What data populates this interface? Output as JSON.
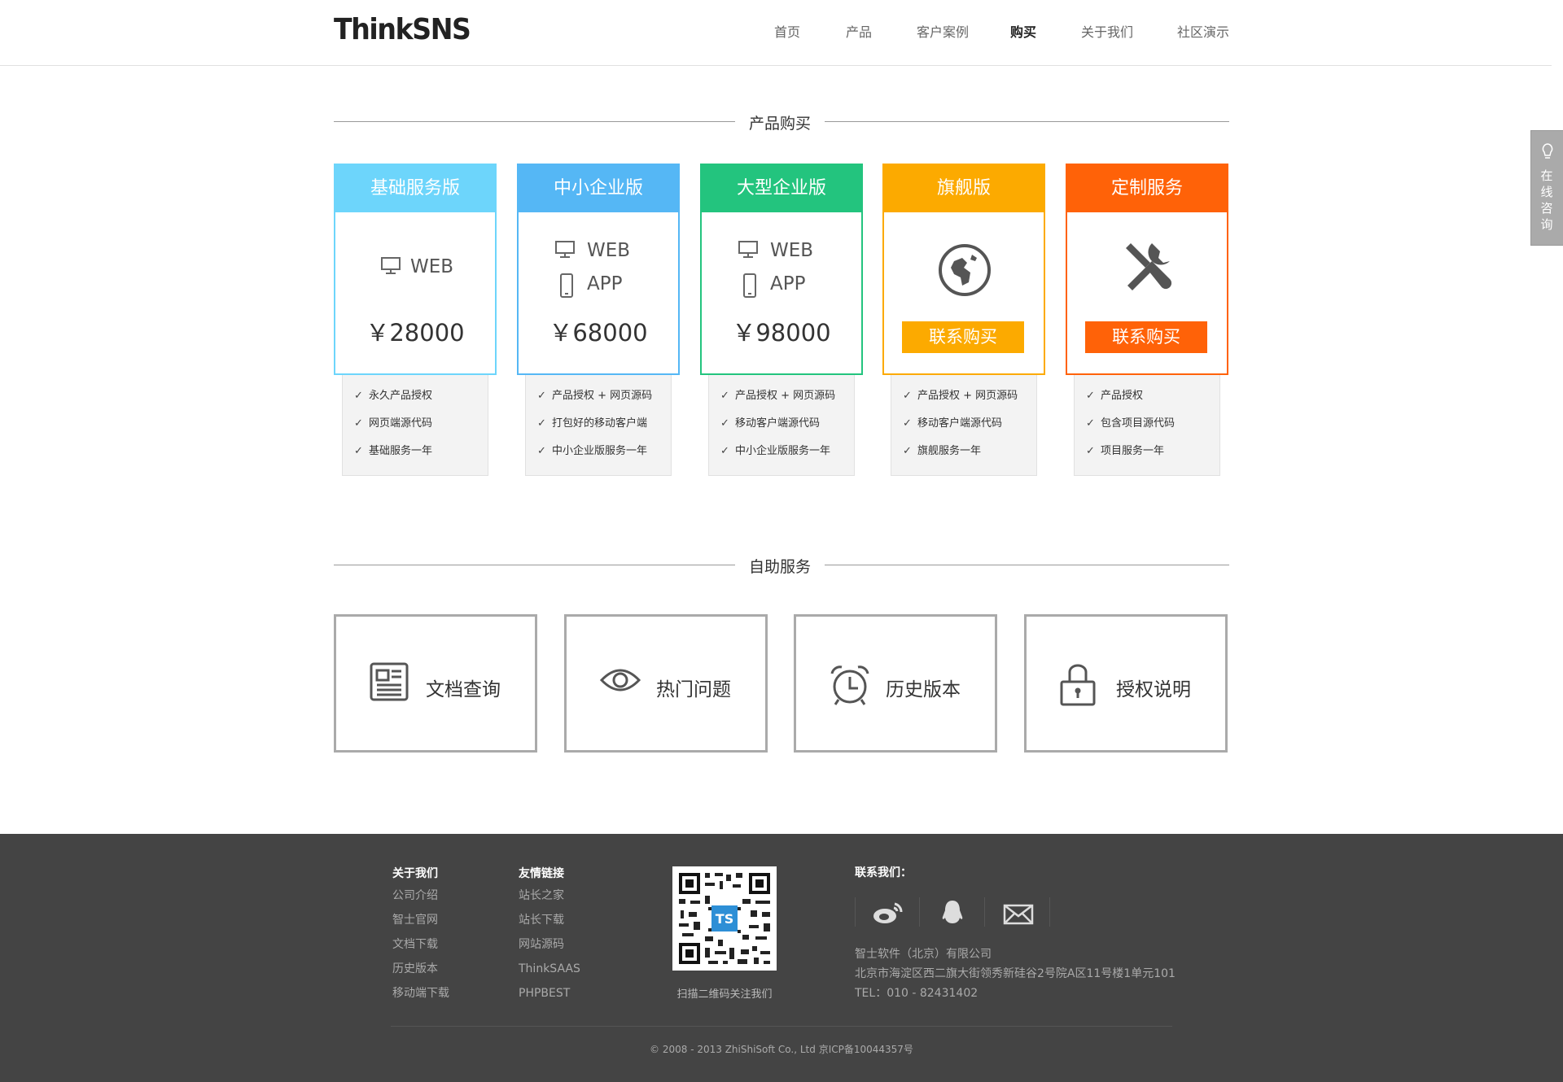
{
  "logo": "ThinkSNS",
  "nav": [
    "首页",
    "产品",
    "客户案例",
    "购买",
    "关于我们",
    "社区演示"
  ],
  "nav_active": "购买",
  "sections": {
    "purchase": "产品购买",
    "self_service": "自助服务"
  },
  "plans": [
    {
      "name": "基础服务版",
      "color": "#6dd5fb",
      "platforms": [
        "WEB"
      ],
      "price": "￥28000",
      "features": [
        "永久产品授权",
        "网页端源代码",
        "基础服务一年"
      ]
    },
    {
      "name": "中小企业版",
      "color": "#55b7f5",
      "platforms": [
        "WEB",
        "APP"
      ],
      "price": "￥68000",
      "features": [
        "产品授权 + 网页源码",
        "打包好的移动客户端",
        "中小企业版服务一年"
      ]
    },
    {
      "name": "大型企业版",
      "color": "#23c47e",
      "platforms": [
        "WEB",
        "APP"
      ],
      "price": "￥98000",
      "features": [
        "产品授权 + 网页源码",
        "移动客户端源代码",
        "中小企业版服务一年"
      ]
    },
    {
      "name": "旗舰版",
      "color": "#fcaa00",
      "icon": "globe-icon",
      "button": "联系购买",
      "features": [
        "产品授权 + 网页源码",
        "移动客户端源代码",
        "旗舰服务一年"
      ]
    },
    {
      "name": "定制服务",
      "color": "#ff6208",
      "icon": "wrench-screwdriver-icon",
      "button": "联系购买",
      "features": [
        "产品授权",
        "包含项目源代码",
        "项目服务一年"
      ]
    }
  ],
  "services": [
    {
      "label": "文档查询",
      "icon": "document-icon"
    },
    {
      "label": "热门问题",
      "icon": "eye-icon"
    },
    {
      "label": "历史版本",
      "icon": "alarm-clock-icon"
    },
    {
      "label": "授权说明",
      "icon": "lock-icon"
    }
  ],
  "consult": "在线咨询",
  "footer": {
    "about": {
      "title": "关于我们",
      "links": [
        "公司介绍",
        "智士官网",
        "文档下载",
        "历史版本",
        "移动端下载"
      ]
    },
    "friends": {
      "title": "友情链接",
      "links": [
        "站长之家",
        "站长下载",
        "网站源码",
        "ThinkSAAS",
        "PHPBEST"
      ]
    },
    "qr_caption": "扫描二维码关注我们",
    "qr_badge": "TS",
    "contact_title": "联系我们：",
    "social": [
      "weibo-icon",
      "qq-icon",
      "mail-icon"
    ],
    "company": "智士软件（北京）有限公司",
    "address": "北京市海淀区西二旗大街领秀新硅谷2号院A区11号楼1单元101",
    "tel": "TEL：010 - 82431402",
    "copyright": "© 2008 - 2013 ZhiShiSoft Co., Ltd 京ICP备10044357号"
  }
}
